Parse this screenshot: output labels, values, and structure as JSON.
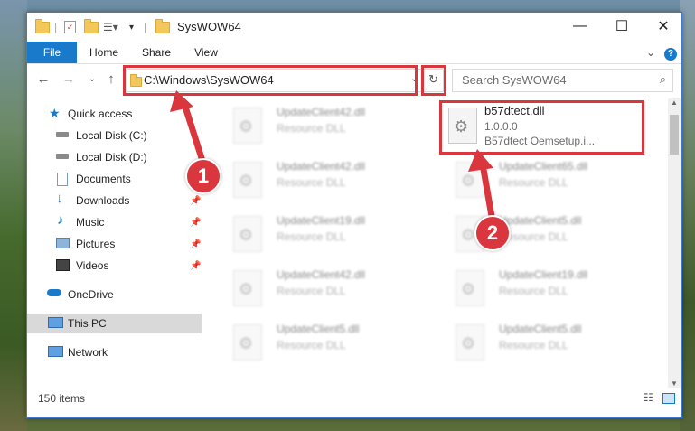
{
  "window": {
    "title": "SysWOW64"
  },
  "ribbon": {
    "tabs": [
      "File",
      "Home",
      "Share",
      "View"
    ]
  },
  "address": {
    "path": "C:\\Windows\\SysWOW64"
  },
  "search": {
    "placeholder": "Search SysWOW64"
  },
  "sidebar": {
    "items": [
      {
        "label": "Quick access",
        "icon": "star-icon"
      },
      {
        "label": "Local Disk (C:)",
        "icon": "drive-icon"
      },
      {
        "label": "Local Disk (D:)",
        "icon": "drive-icon"
      },
      {
        "label": "Documents",
        "icon": "documents-icon"
      },
      {
        "label": "Downloads",
        "icon": "download-icon"
      },
      {
        "label": "Music",
        "icon": "music-icon"
      },
      {
        "label": "Pictures",
        "icon": "pictures-icon"
      },
      {
        "label": "Videos",
        "icon": "videos-icon"
      },
      {
        "label": "OneDrive",
        "icon": "cloud-icon"
      },
      {
        "label": "This PC",
        "icon": "computer-icon"
      },
      {
        "label": "Network",
        "icon": "network-icon"
      }
    ]
  },
  "files": {
    "highlighted": {
      "name": "b57dtect.dll",
      "version": "1.0.0.0",
      "desc": "B57dtect Oemsetup.i..."
    },
    "left_col": [
      {
        "name": "UpdateClient42.dll",
        "type": "Resource DLL"
      },
      {
        "name": "UpdateClient42.dll",
        "type": "Resource DLL"
      },
      {
        "name": "UpdateClient19.dll",
        "type": "Resource DLL"
      },
      {
        "name": "UpdateClient42.dll",
        "type": "Resource DLL"
      },
      {
        "name": "UpdateClient5.dll",
        "type": "Resource DLL"
      }
    ],
    "right_col": [
      {
        "name": "UpdateClient65.dll",
        "type": "Resource DLL"
      },
      {
        "name": "UpdateClient5.dll",
        "type": "Resource DLL"
      },
      {
        "name": "UpdateClient19.dll",
        "type": "Resource DLL"
      },
      {
        "name": "UpdateClient5.dll",
        "type": "Resource DLL"
      }
    ]
  },
  "status": {
    "count": "150 items"
  },
  "callouts": [
    "1",
    "2"
  ],
  "colors": {
    "accent": "#1979ca",
    "highlight": "#d9363e"
  }
}
